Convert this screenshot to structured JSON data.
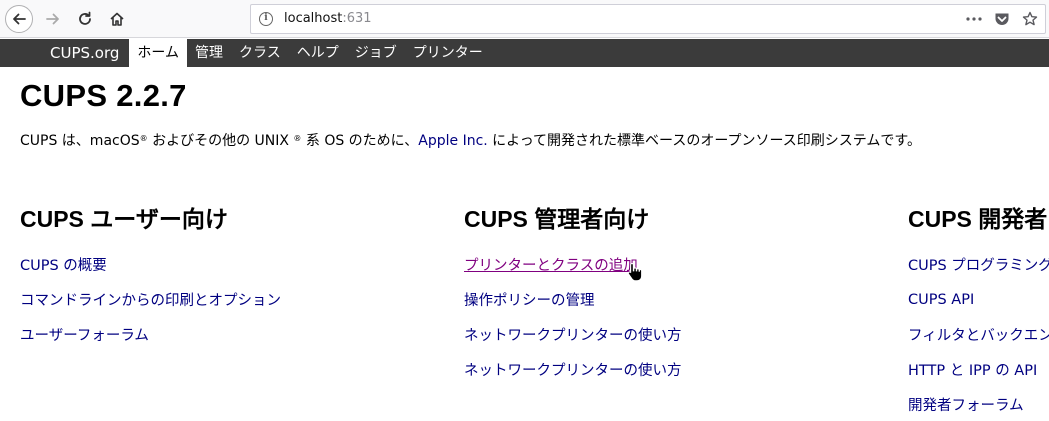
{
  "browser": {
    "url_host": "localhost",
    "url_port": ":631",
    "icons": [
      "back-arrow-icon",
      "forward-arrow-icon",
      "reload-icon",
      "home-icon",
      "info-icon",
      "more-icon",
      "pocket-icon",
      "bookmark-star-icon"
    ]
  },
  "nav": {
    "brand": "CUPS.org",
    "items": [
      {
        "label": "ホーム",
        "active": true
      },
      {
        "label": "管理"
      },
      {
        "label": "クラス"
      },
      {
        "label": "ヘルプ"
      },
      {
        "label": "ジョブ"
      },
      {
        "label": "プリンター"
      }
    ]
  },
  "page": {
    "title": "CUPS 2.2.7",
    "intro": {
      "part1": "CUPS は、macOS",
      "reg1": "®",
      "part2": " およびその他の UNIX ",
      "reg2": "®",
      "part3": " 系 OS のために、",
      "link": "Apple Inc.",
      "part4": " によって開発された標準ベースのオープンソース印刷システムです。"
    }
  },
  "columns": {
    "users": {
      "heading": "CUPS ユーザー向け",
      "links": [
        "CUPS の概要",
        "コマンドラインからの印刷とオプション",
        "ユーザーフォーラム"
      ]
    },
    "admin": {
      "heading": "CUPS 管理者向け",
      "links": [
        "プリンターとクラスの追加",
        "操作ポリシーの管理",
        "ネットワークプリンターの使い方",
        "ネットワークプリンターの使い方"
      ]
    },
    "dev": {
      "heading": "CUPS 開発者",
      "links": [
        "CUPS プログラミング",
        "CUPS API",
        "フィルタとバックエンド",
        "HTTP と IPP の API",
        "開発者フォーラム"
      ]
    }
  }
}
